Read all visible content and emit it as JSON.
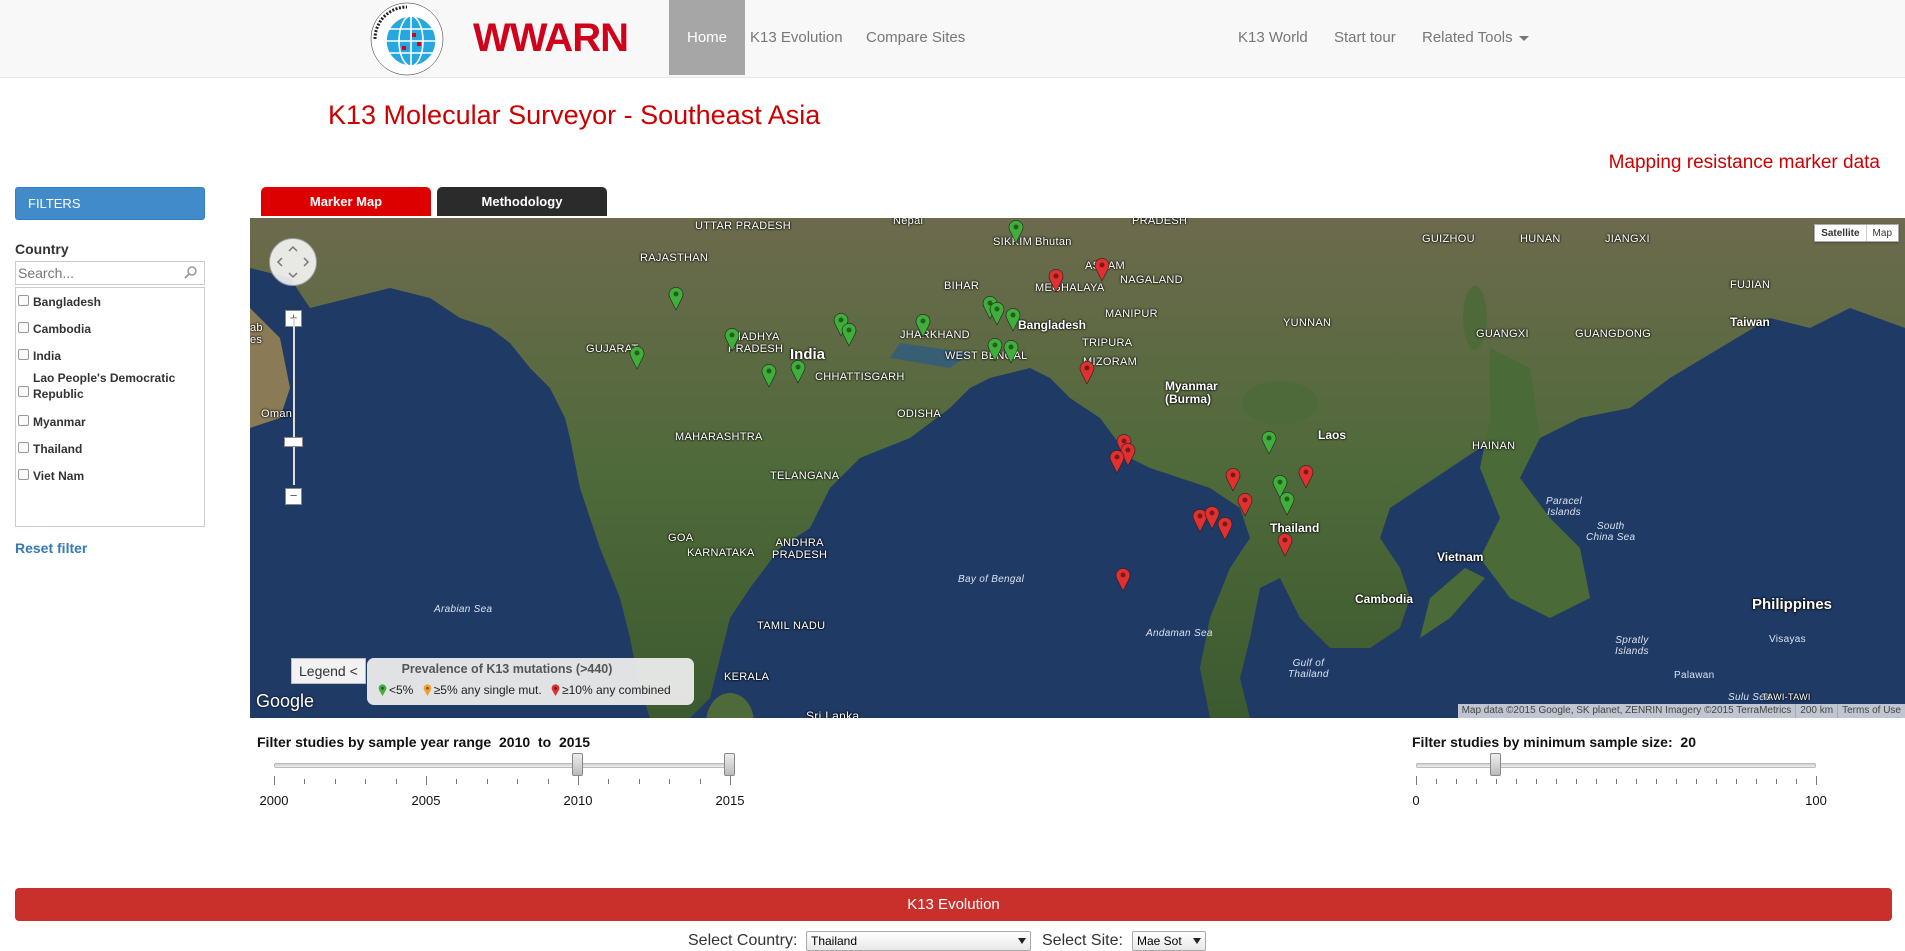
{
  "nav": {
    "logo_text": "WWARN",
    "logo_ring_text": "WORLDWIDE ANTIMALARIAL RESISTANCE NETWORK",
    "links": [
      "Home",
      "K13 Evolution",
      "Compare Sites"
    ],
    "right_links": [
      "K13 World",
      "Start tour",
      "Related Tools"
    ]
  },
  "page": {
    "title": "K13 Molecular Surveyor - Southeast Asia",
    "subtitle": "Mapping resistance marker data"
  },
  "filters": {
    "header": "FILTERS",
    "country_label": "Country",
    "search_placeholder": "Search...",
    "countries": [
      "Bangladesh",
      "Cambodia",
      "India",
      "Lao People's Democratic Republic",
      "Myanmar",
      "Thailand",
      "Viet Nam"
    ],
    "reset": "Reset filter"
  },
  "tabs": [
    "Marker Map",
    "Methodology"
  ],
  "map": {
    "map_type": [
      "Satellite",
      "Map"
    ],
    "labels": {
      "uttar": "UTTAR\nPRADESH",
      "nepal": "Nepal",
      "sikkim": "SIKKIM",
      "bhutan": "Bhutan",
      "pradesh_top": "PRADESH",
      "rajasthan": "RAJASTHAN",
      "bihar": "BIHAR",
      "assam": "ASSAM",
      "meghalaya": "MEGHALAYA",
      "nagaland": "NAGALAND",
      "guizhou": "GUIZHOU",
      "hunan": "HUNAN",
      "jiangxi": "JIANGXI",
      "fujian": "FUJIAN",
      "jharkhand": "JHARKHAND",
      "bangladesh": "Bangladesh",
      "manipur": "MANIPUR",
      "yunnan": "YUNNAN",
      "taiwan": "Taiwan",
      "madhya": "MADHYA\nPRADESH",
      "india": "India",
      "tripura": "TRIPURA",
      "guangxi": "GUANGXI",
      "guangdong": "GUANGDONG",
      "gujarat": "GUJARAT",
      "westbengal": "WEST BENGAL",
      "mizoram": "MIZORAM",
      "chhattisgarh": "CHHATTISGARH",
      "oman": "Oman",
      "myanmar": "Myanmar\n(Burma)",
      "odisha": "ODISHA",
      "maharashtra": "MAHARASHTRA",
      "laos": "Laos",
      "hainan": "HAINAN",
      "telangana": "TELANGANA",
      "paracel": "Paracel\nIslands",
      "thailand": "Thailand",
      "southchina": "South\nChina Sea",
      "goa": "GOA",
      "andhra": "ANDHRA\nPRADESH",
      "karnataka": "KARNATAKA",
      "vietnam": "Vietnam",
      "bayofbengal": "Bay of Bengal",
      "cambodia": "Cambodia",
      "philippines": "Philippines",
      "arabiansea": "Arabian Sea",
      "tamilnadu": "TAMIL NADU",
      "andamansea": "Andaman Sea",
      "spratly": "Spratly\nIslands",
      "visayas": "Visayas",
      "kerala": "KERALA",
      "gulfthailand": "Gulf of\nThailand",
      "palawan": "Palawan",
      "srilanka": "Sri Lanka",
      "sulusea": "Sulu Sea",
      "tawitawi": "TAWI-TAWI",
      "ab": "ab\nes"
    },
    "legend_button": "Legend <",
    "legend_title": "Prevalence of K13 mutations (>440)",
    "legend_items": [
      "<5%",
      "≥5% any single mut.",
      "≥10% any combined"
    ],
    "legend_colors": [
      "#3fae3a",
      "#f0a030",
      "#e03030"
    ],
    "google": "Google",
    "attribution": [
      "Map data ©2015 Google, SK planet, ZENRIN Imagery ©2015 TerraMetrics",
      "200 km",
      "Terms of Use"
    ],
    "zoom_in": "+",
    "zoom_out": "−"
  },
  "year_slider": {
    "label_prefix": "Filter studies by sample year range",
    "from": "2010",
    "to_word": "to",
    "to": "2015",
    "ticks": [
      "2000",
      "2005",
      "2010",
      "2015"
    ],
    "min": 2000,
    "max": 2015,
    "low": 2010,
    "high": 2015
  },
  "size_slider": {
    "label_prefix": "Filter studies by minimum sample size:",
    "value": "20",
    "ticks": [
      "0",
      "100"
    ],
    "min": 0,
    "max": 100,
    "current": 20
  },
  "evolution": {
    "bar": "K13 Evolution",
    "country_label": "Select Country:",
    "country_value": "Thailand",
    "site_label": "Select Site:",
    "site_value": "Mae Sot"
  },
  "colors": {
    "accent_red": "#cc0000",
    "filters_blue": "#428bca",
    "pin_green": "#3fae3a",
    "pin_red": "#e03030"
  }
}
